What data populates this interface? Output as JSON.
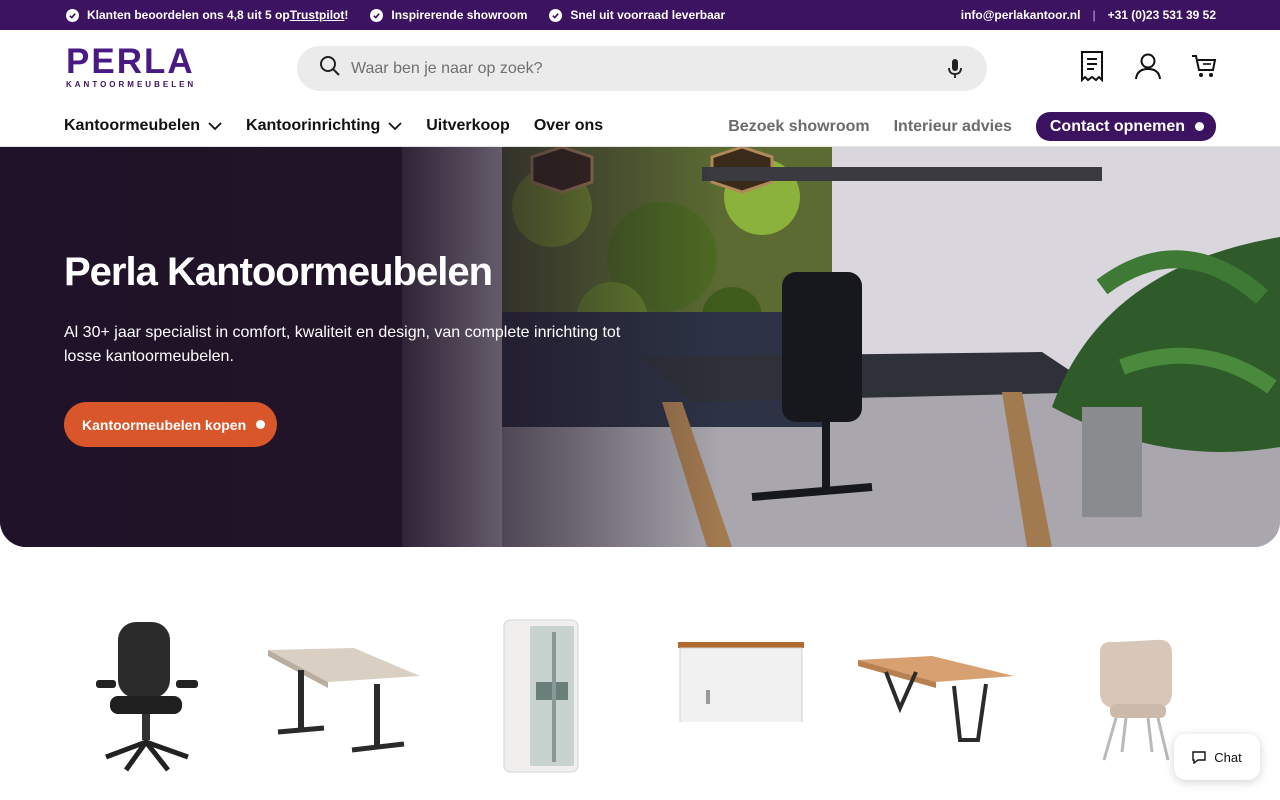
{
  "announcement": {
    "usps": [
      {
        "text": "Klanten beoordelen ons 4,8 uit 5 op ",
        "link": "Trustpilot",
        "suffix": "!"
      },
      {
        "text": "Inspirerende showroom"
      },
      {
        "text": "Snel uit voorraad leverbaar"
      }
    ],
    "email": "info@perlakantoor.nl",
    "separator": "|",
    "phone": "+31 (0)23 531 39 52"
  },
  "header": {
    "logo_word": "PERLA",
    "logo_sub": "KANTOORMEUBELEN",
    "search_placeholder": "Waar ben je naar op zoek?"
  },
  "nav": {
    "left": [
      {
        "label": "Kantoormeubelen",
        "dropdown": true
      },
      {
        "label": "Kantoorinrichting",
        "dropdown": true
      },
      {
        "label": "Uitverkoop",
        "dropdown": false
      },
      {
        "label": "Over ons",
        "dropdown": false
      }
    ],
    "right": [
      {
        "label": "Bezoek showroom"
      },
      {
        "label": "Interieur advies"
      }
    ],
    "contact_label": "Contact opnemen"
  },
  "hero": {
    "title": "Perla Kantoormeubelen",
    "text": "Al 30+ jaar specialist in comfort, kwaliteit en design, van complete inrichting tot losse kantoormeubelen.",
    "button": "Kantoormeubelen kopen"
  },
  "categories": [
    "office-chair",
    "sit-stand-desk",
    "phone-booth",
    "roller-cabinet",
    "meeting-table",
    "lounge-chair"
  ],
  "chat": {
    "label": "Chat"
  },
  "colors": {
    "brand": "#3c1361",
    "accent": "#d9562a"
  }
}
